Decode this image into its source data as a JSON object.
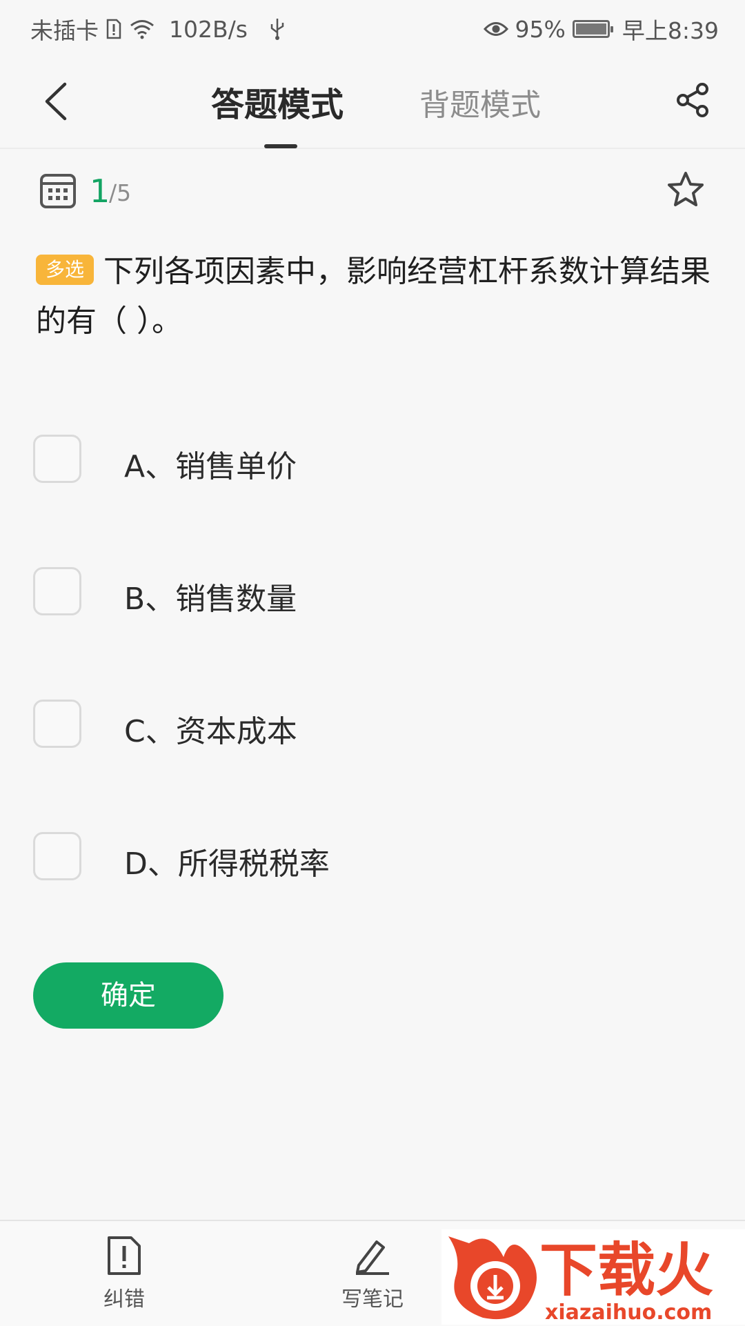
{
  "status_bar": {
    "sim": "未插卡",
    "speed": "102B/s",
    "battery": "95%",
    "time": "早上8:39"
  },
  "nav": {
    "tab_answer": "答题模式",
    "tab_memorize": "背题模式",
    "active_tab": "答题模式",
    "back_icon": "chevron-left-icon",
    "share_icon": "share-icon"
  },
  "progress": {
    "current": "1",
    "total": "/5",
    "calendar_icon": "calendar-icon",
    "favorite_icon": "star-outline-icon"
  },
  "question": {
    "tag": "多选",
    "text": "下列各项因素中，影响经营杠杆系数计算结果的有（ ）。"
  },
  "options": [
    {
      "label": "A、销售单价",
      "checked": false
    },
    {
      "label": "B、销售数量",
      "checked": false
    },
    {
      "label": "C、资本成本",
      "checked": false
    },
    {
      "label": "D、所得税税率",
      "checked": false
    }
  ],
  "confirm_label": "确定",
  "bottom_bar": {
    "error_label": "纠错",
    "note_label": "写笔记"
  },
  "watermark": {
    "brand": "下载火",
    "domain": "xiazaihuo.com"
  },
  "colors": {
    "accent": "#13aa63",
    "tag": "#f8b53a"
  }
}
